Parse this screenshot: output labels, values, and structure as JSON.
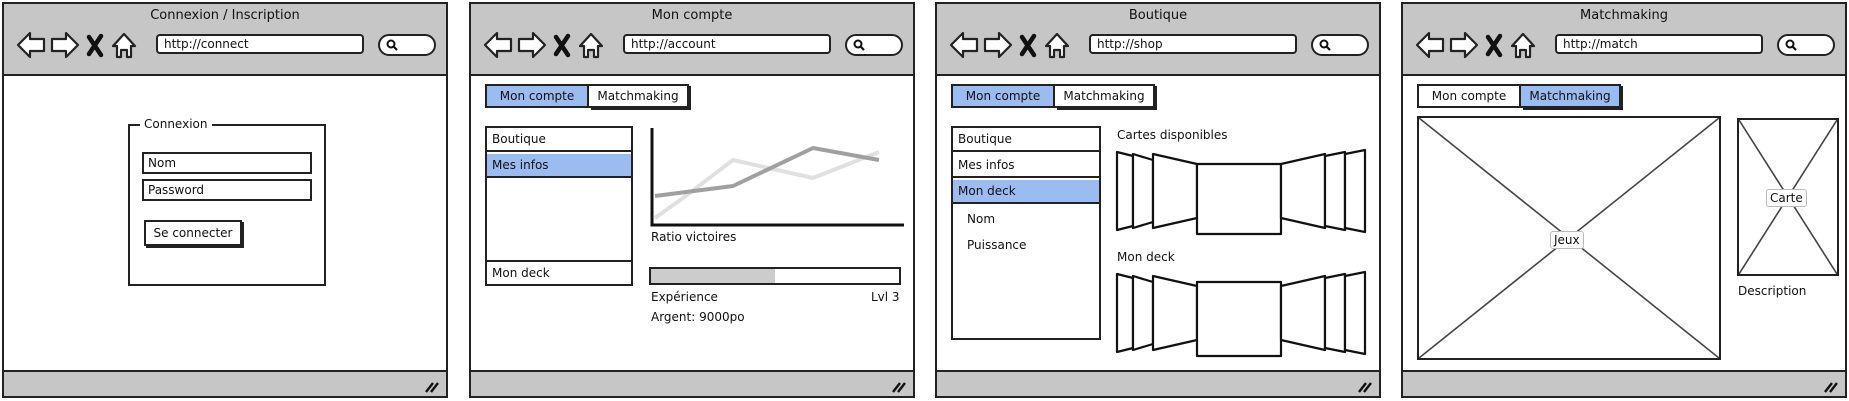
{
  "windows": [
    {
      "title": "Connexion / Inscription",
      "url": "http://connect",
      "fieldset_legend": "Connexion",
      "name_placeholder": "Nom",
      "password_placeholder": "Password",
      "submit_label": "Se connecter"
    },
    {
      "title": "Mon compte",
      "url": "http://account",
      "tabs": [
        "Mon compte",
        "Matchmaking"
      ],
      "active_tab": "Mon compte",
      "menu": [
        "Boutique",
        "Mes infos",
        "Mon deck"
      ],
      "selected_menu": "Mes infos",
      "chart_caption": "Ratio victoires",
      "xp_label": "Expérience",
      "xp_progress": 0.5,
      "level_label": "Lvl 3",
      "money_label": "Argent: 9000po"
    },
    {
      "title": "Boutique",
      "url": "http://shop",
      "tabs": [
        "Mon compte",
        "Matchmaking"
      ],
      "active_tab": "Mon compte",
      "menu": [
        "Boutique",
        "Mes infos",
        "Mon deck",
        "Nom",
        "Puissance"
      ],
      "selected_menu": "Mon deck",
      "available_cards_label": "Cartes disponibles",
      "my_deck_label": "Mon deck"
    },
    {
      "title": "Matchmaking",
      "url": "http://match",
      "tabs": [
        "Mon compte",
        "Matchmaking"
      ],
      "active_tab": "Matchmaking",
      "game_label": "Jeux",
      "card_label": "Carte",
      "description_label": "Description"
    }
  ],
  "icons": [
    "back-arrow-icon",
    "forward-arrow-icon",
    "close-x-icon",
    "home-icon",
    "search-icon",
    "resize-grip-icon"
  ],
  "colors": {
    "chrome": "#c6c6c6",
    "selected": "#9bbcf0",
    "chart_dark": "#a0a0a0",
    "chart_light": "#e0e0e0"
  }
}
